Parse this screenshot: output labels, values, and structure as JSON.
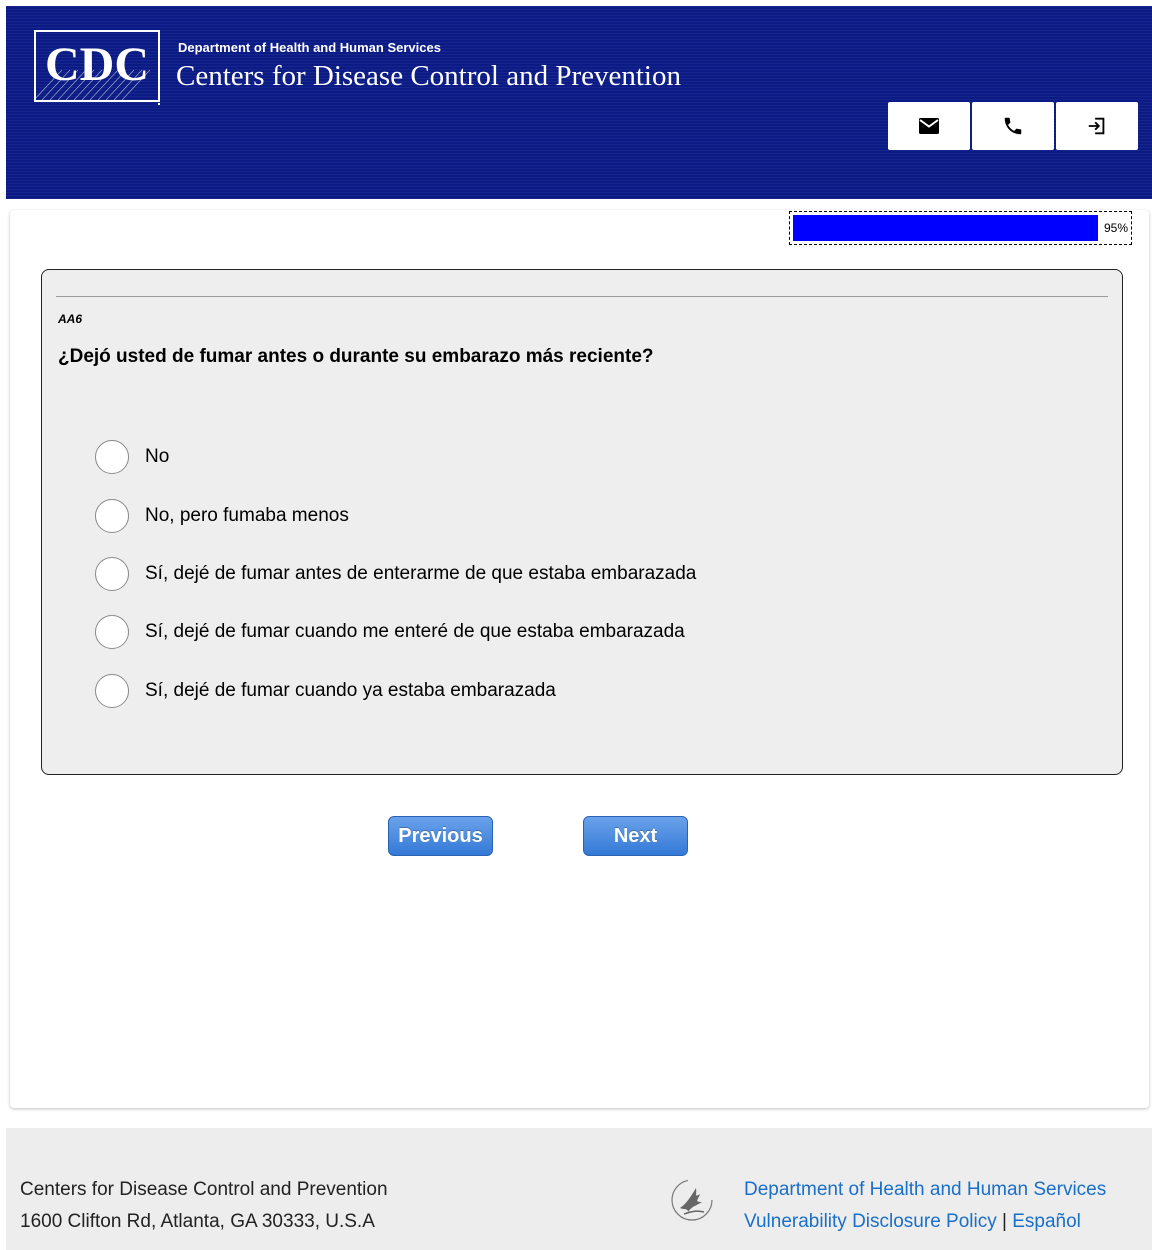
{
  "header": {
    "logo_text": "CDC",
    "department": "Department of Health and Human Services",
    "agency": "Centers for Disease Control and Prevention",
    "background_color": "#0b1a85",
    "utility_icons": [
      "email-icon",
      "phone-icon",
      "logout-icon"
    ]
  },
  "progress": {
    "percent": 95,
    "label": "95%",
    "fill_color": "#0000ff"
  },
  "question": {
    "code": "AA6",
    "text": "¿Dejó usted de fumar antes o durante su embarazo más reciente?",
    "options": [
      "No",
      "No, pero fumaba menos",
      "Sí, dejé de fumar antes de enterarme de que estaba embarazada",
      "Sí, dejé de fumar cuando me enteré de que estaba embarazada",
      "Sí, dejé de fumar cuando ya estaba embarazada"
    ]
  },
  "navigation": {
    "previous_label": "Previous",
    "next_label": "Next",
    "button_color": "#3b82d8"
  },
  "footer": {
    "org_name": "Centers for Disease Control and Prevention",
    "address": "1600 Clifton Rd, Atlanta, GA 30333, U.S.A",
    "hhs_link": "Department of Health and Human Services",
    "vdp_link": "Vulnerability Disclosure Policy",
    "separator": "|",
    "spanish_link": "Español",
    "link_color": "#1a6fc8"
  }
}
